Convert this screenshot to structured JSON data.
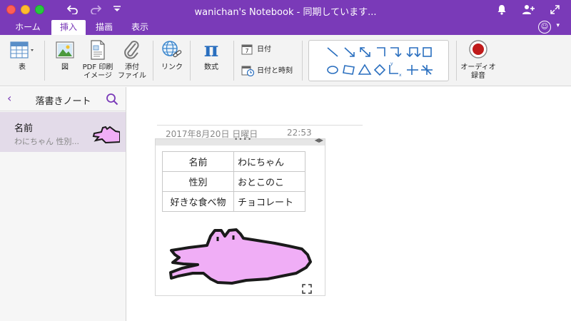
{
  "window": {
    "title": "wanichan's Notebook - 同期しています..."
  },
  "tabs": [
    {
      "label": "ホーム",
      "active": false
    },
    {
      "label": "挿入",
      "active": true
    },
    {
      "label": "描画",
      "active": false
    },
    {
      "label": "表示",
      "active": false
    }
  ],
  "ribbon": {
    "table_label": "表",
    "picture_label": "図",
    "pdf_label_1": "PDF 印刷",
    "pdf_label_2": "イメージ",
    "attach_label_1": "添付",
    "attach_label_2": "ファイル",
    "link_label": "リンク",
    "equation_label": "数式",
    "equation_symbol": "π",
    "date_label": "日付",
    "date_icon_day": "7",
    "datetime_label": "日付と時刻",
    "audio_label_1": "オーディオ",
    "audio_label_2": "録音"
  },
  "sidebar": {
    "back_glyph": "‹",
    "section_title": "落書きノート",
    "pages": [
      {
        "title": "名前",
        "preview": "わにちゃん  性別..."
      }
    ]
  },
  "page": {
    "date": "2017年8月20日 日曜日",
    "time": "22:53",
    "table": [
      {
        "key": "名前",
        "value": "わにちゃん"
      },
      {
        "key": "性別",
        "value": "おとこのこ"
      },
      {
        "key": "好きな食べ物",
        "value": "チョコレート"
      }
    ]
  },
  "colors": {
    "accent": "#7a3ab8",
    "croc_fill": "#f0aef6",
    "croc_outline": "#1a1a1a"
  }
}
